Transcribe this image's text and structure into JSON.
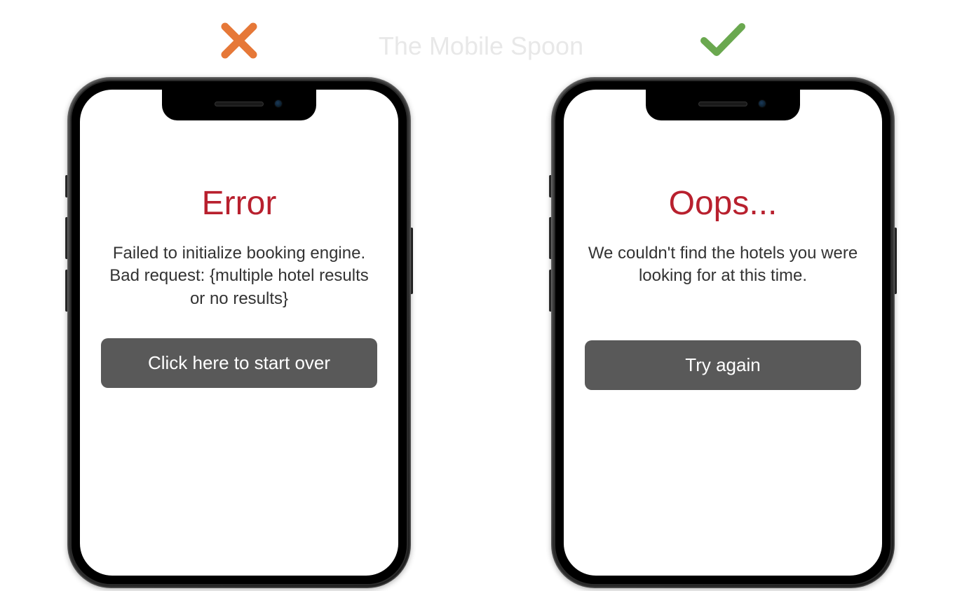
{
  "watermark": "The Mobile Spoon",
  "icons": {
    "cross": "cross-icon",
    "check": "check-icon"
  },
  "colors": {
    "bad": "#e67838",
    "good": "#6aa84f",
    "title": "#b8202e",
    "button": "#595959"
  },
  "bad_example": {
    "title": "Error",
    "message": "Failed to initialize booking engine. Bad request: {multiple hotel results or no results}",
    "button_label": "Click here to start over"
  },
  "good_example": {
    "title": "Oops...",
    "message": "We couldn't find the hotels you were looking for at this time.",
    "button_label": "Try again"
  }
}
